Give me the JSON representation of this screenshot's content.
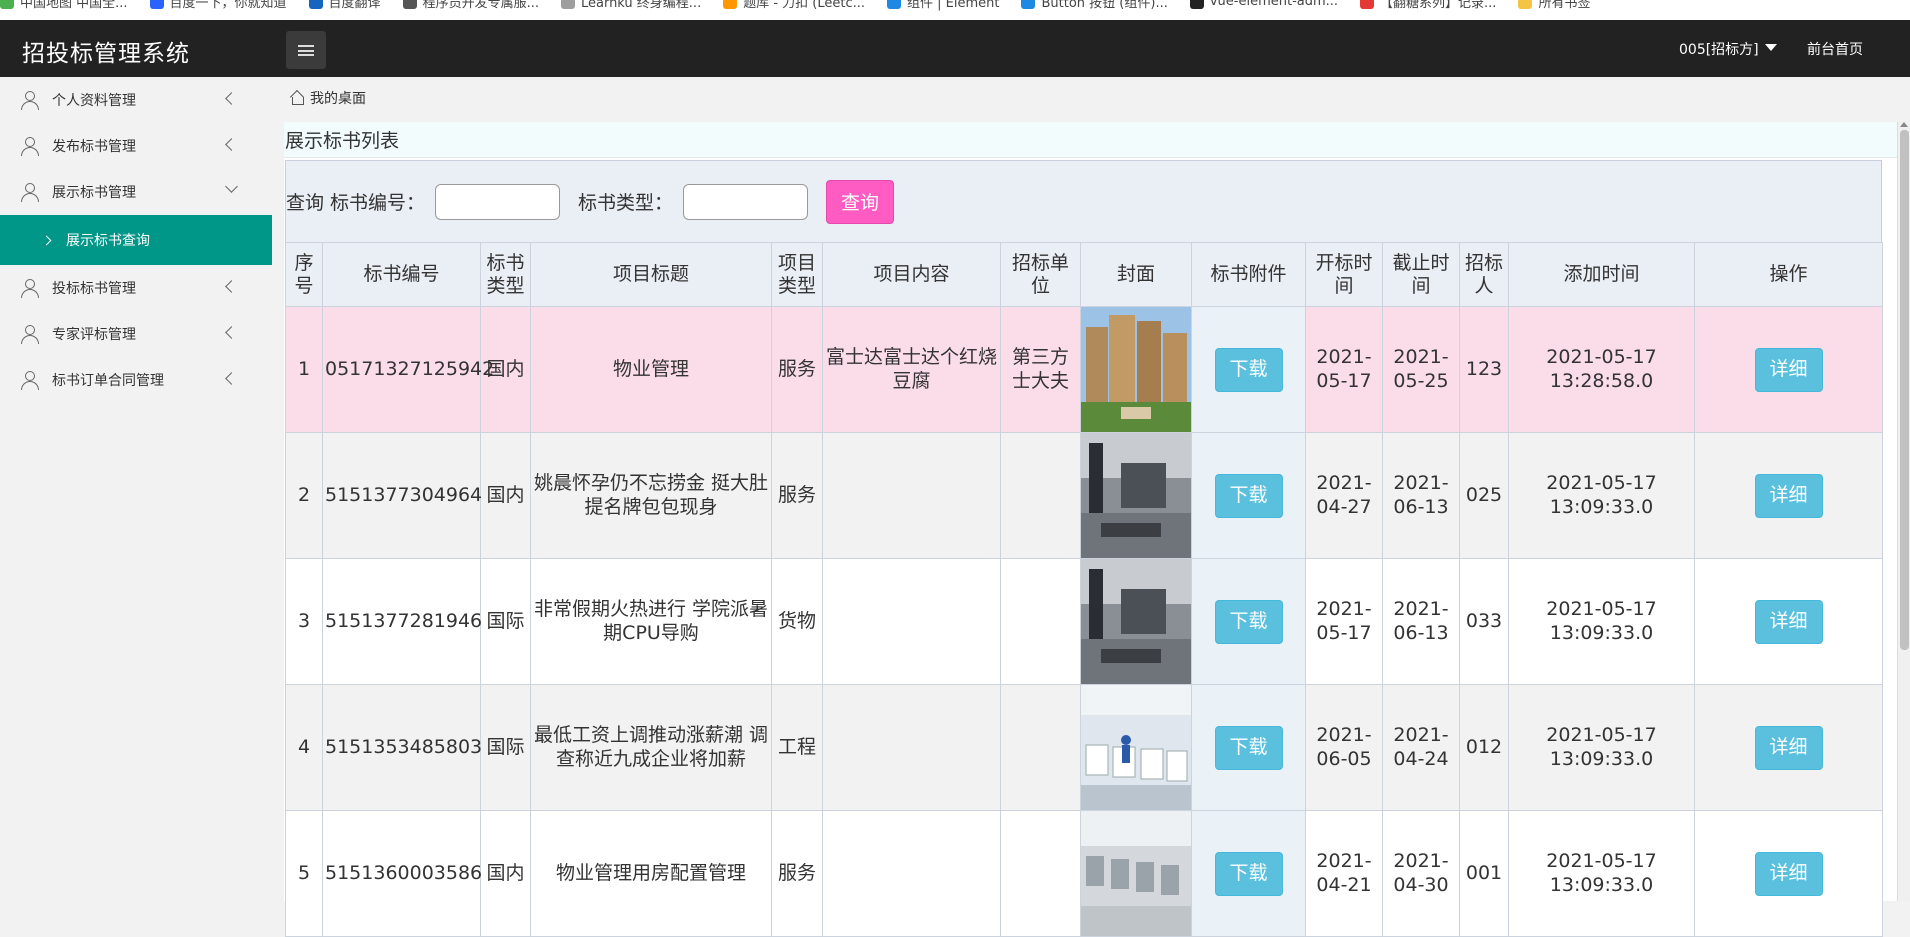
{
  "bookmarks": [
    "中国地图 中国全...",
    "百度一下，你就知道",
    "百度翻译",
    "程序员开发专属服...",
    "Learnku 终身编程...",
    "题库 - 力扣 (Leetc...",
    "组件 | Element",
    "Button 按钮 (组件)...",
    "vue-element-adm...",
    "【翻糖系列】记录...",
    "所有书签"
  ],
  "header": {
    "brand": "招投标管理系统",
    "user": "005[招标方]",
    "front_link": "前台首页"
  },
  "sidebar": {
    "items": [
      {
        "label": "个人资料管理"
      },
      {
        "label": "发布标书管理"
      },
      {
        "label": "展示标书管理"
      },
      {
        "label": "投标标书管理"
      },
      {
        "label": "专家评标管理"
      },
      {
        "label": "标书订单合同管理"
      }
    ],
    "active_sub": "展示标书查询"
  },
  "breadcrumb": "我的桌面",
  "panel": {
    "title": "展示标书列表",
    "search_prefix": "查询 标书编号：",
    "type_label": "标书类型：",
    "search_button": "查询"
  },
  "table": {
    "headers": [
      "序号",
      "标书编号",
      "标书类型",
      "项目标题",
      "项目类型",
      "项目内容",
      "招标单位",
      "封面",
      "标书附件",
      "开标时间",
      "截止时间",
      "招标人",
      "添加时间",
      "操作"
    ],
    "download_label": "下载",
    "detail_label": "详细",
    "rows": [
      {
        "no": "1",
        "code": "05171327125942",
        "type": "国内",
        "title": "物业管理",
        "ptype": "服务",
        "content": "富士达富士达个红烧豆腐",
        "unit": "第三方士大夫",
        "open": "2021-05-17",
        "close": "2021-05-25",
        "person": "123",
        "added": "2021-05-17 13:28:58.0",
        "cover": "cover-buildings"
      },
      {
        "no": "2",
        "code": "5151377304964",
        "type": "国内",
        "title": "姚晨怀孕仍不忘捞金 挺大肚提名牌包包现身",
        "ptype": "服务",
        "content": "",
        "unit": "",
        "open": "2021-04-27",
        "close": "2021-06-13",
        "person": "025",
        "added": "2021-05-17 13:09:33.0",
        "cover": "cover-workshop"
      },
      {
        "no": "3",
        "code": "5151377281946",
        "type": "国际",
        "title": "非常假期火热进行 学院派暑期CPU导购",
        "ptype": "货物",
        "content": "",
        "unit": "",
        "open": "2021-05-17",
        "close": "2021-06-13",
        "person": "033",
        "added": "2021-05-17 13:09:33.0",
        "cover": "cover-workshop"
      },
      {
        "no": "4",
        "code": "5151353485803",
        "type": "国际",
        "title": "最低工资上调推动涨薪潮 调查称近九成企业将加薪",
        "ptype": "工程",
        "content": "",
        "unit": "",
        "open": "2021-06-05",
        "close": "2021-04-24",
        "person": "012",
        "added": "2021-05-17 13:09:33.0",
        "cover": "cover-factory"
      },
      {
        "no": "5",
        "code": "5151360003586",
        "type": "国内",
        "title": "物业管理用房配置管理",
        "ptype": "服务",
        "content": "",
        "unit": "",
        "open": "2021-04-21",
        "close": "2021-04-30",
        "person": "001",
        "added": "2021-05-17 13:09:33.0",
        "cover": "cover-hall"
      }
    ]
  }
}
